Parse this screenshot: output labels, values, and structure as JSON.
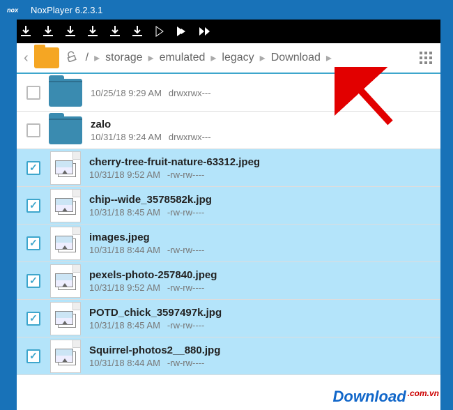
{
  "window": {
    "title": "NoxPlayer 6.2.3.1"
  },
  "breadcrumb": {
    "root": "/",
    "segments": [
      "storage",
      "emulated",
      "legacy",
      "Download"
    ]
  },
  "files": [
    {
      "name": "",
      "date": "10/25/18 9:29 AM",
      "perms": "drwxrwx---",
      "type": "folder",
      "selected": false
    },
    {
      "name": "zalo",
      "date": "10/31/18 9:24 AM",
      "perms": "drwxrwx---",
      "type": "folder",
      "selected": false
    },
    {
      "name": "cherry-tree-fruit-nature-63312.jpeg",
      "date": "10/31/18 9:52 AM",
      "perms": "-rw-rw----",
      "type": "image",
      "selected": true
    },
    {
      "name": "chip--wide_3578582k.jpg",
      "date": "10/31/18 8:45 AM",
      "perms": "-rw-rw----",
      "type": "image",
      "selected": true
    },
    {
      "name": "images.jpeg",
      "date": "10/31/18 8:44 AM",
      "perms": "-rw-rw----",
      "type": "image",
      "selected": true
    },
    {
      "name": "pexels-photo-257840.jpeg",
      "date": "10/31/18 9:52 AM",
      "perms": "-rw-rw----",
      "type": "image",
      "selected": true
    },
    {
      "name": "POTD_chick_3597497k.jpg",
      "date": "10/31/18 8:45 AM",
      "perms": "-rw-rw----",
      "type": "image",
      "selected": true
    },
    {
      "name": "Squirrel-photos2__880.jpg",
      "date": "10/31/18 8:44 AM",
      "perms": "-rw-rw----",
      "type": "image",
      "selected": true
    }
  ],
  "watermark": {
    "main": "Download",
    "domain": ".com.vn"
  }
}
